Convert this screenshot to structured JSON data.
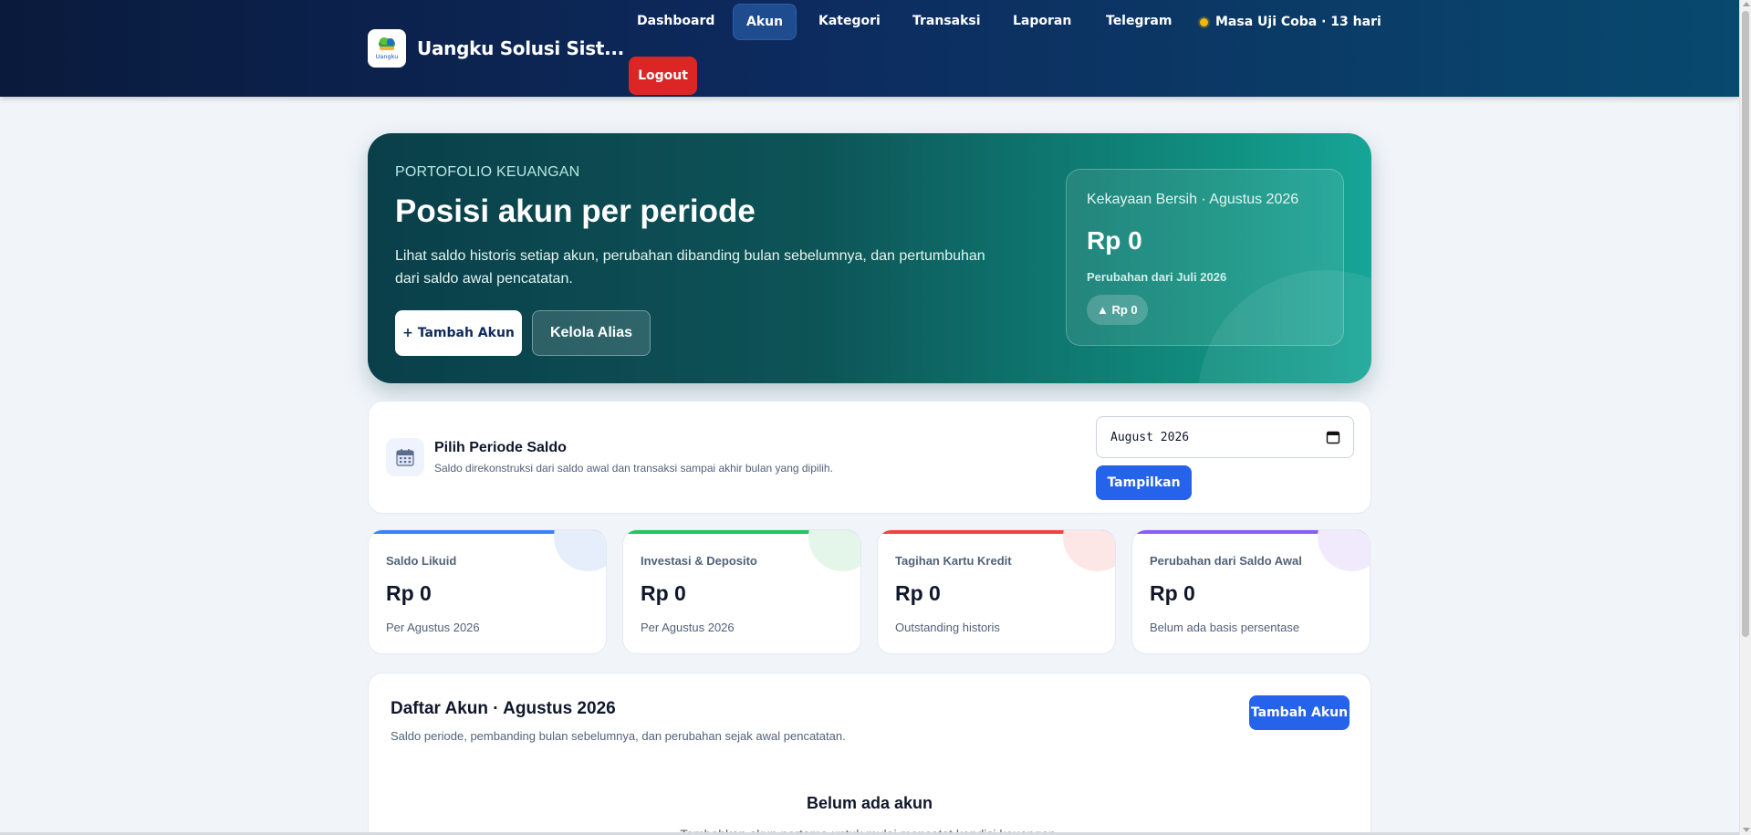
{
  "header": {
    "brand_name": "Uangku Solusi Sist...",
    "brand_logo_text": "Uangku",
    "nav": [
      "Dashboard",
      "Akun",
      "Kategori",
      "Transaksi",
      "Laporan",
      "Telegram"
    ],
    "active_nav": "Akun",
    "trial_status": "Masa Uji Coba · 13 hari",
    "logout_label": "Logout"
  },
  "hero": {
    "eyebrow": "PORTOFOLIO KEUANGAN",
    "title": "Posisi akun per periode",
    "description": "Lihat saldo historis setiap akun, perubahan dibanding bulan sebelumnya, dan pertumbuhan dari saldo awal pencatatan.",
    "add_account_label": "+ Tambah Akun",
    "manage_alias_label": "Kelola Alias",
    "net_worth": {
      "label": "Kekayaan Bersih · Agustus 2026",
      "value": "Rp 0",
      "change_label": "Perubahan dari Juli 2026",
      "change_value": "▲ Rp 0"
    }
  },
  "period": {
    "title": "Pilih Periode Saldo",
    "subtitle": "Saldo direkonstruksi dari saldo awal dan transaksi sampai akhir bulan yang dipilih.",
    "selected_month": "August 2026",
    "show_label": "Tampilkan"
  },
  "stats": [
    {
      "label": "Saldo Likuid",
      "value": "Rp 0",
      "note": "Per Agustus 2026",
      "color": "#3b82f6"
    },
    {
      "label": "Investasi & Deposito",
      "value": "Rp 0",
      "note": "Per Agustus 2026",
      "color": "#22c55e"
    },
    {
      "label": "Tagihan Kartu Kredit",
      "value": "Rp 0",
      "note": "Outstanding historis",
      "color": "#ef4444"
    },
    {
      "label": "Perubahan dari Saldo Awal",
      "value": "Rp 0",
      "note": "Belum ada basis persentase",
      "color": "#8b5cf6"
    }
  ],
  "accounts": {
    "title": "Daftar Akun · Agustus 2026",
    "subtitle": "Saldo periode, pembanding bulan sebelumnya, dan perubahan sejak awal pencatatan.",
    "add_label": "Tambah Akun",
    "empty_title": "Belum ada akun",
    "empty_subtitle": "Tambahkan akun pertama untuk mulai mencatat kondisi keuangan."
  }
}
